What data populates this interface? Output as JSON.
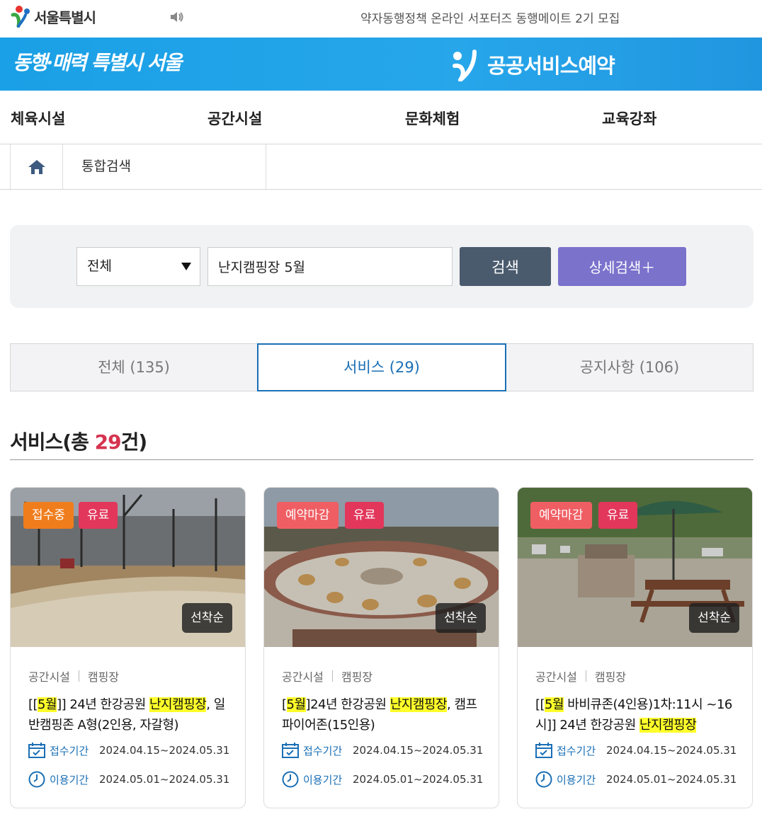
{
  "topbar": {
    "logo_text": "서울특별시",
    "notice": "약자동행정책 온라인 서포터즈 동행메이트 2기 모집"
  },
  "banner": {
    "slogan": "동행·매력 특별시 서울",
    "service_title": "공공서비스예약"
  },
  "nav": {
    "items": [
      "체육시설",
      "공간시설",
      "문화체험",
      "교육강좌"
    ]
  },
  "breadcrumb": {
    "current": "통합검색"
  },
  "search": {
    "category_selected": "전체",
    "query": "난지캠핑장 5월",
    "search_button": "검색",
    "advanced_button": "상세검색＋"
  },
  "tabs": [
    {
      "label": "전체 (135)",
      "active": false
    },
    {
      "label": "서비스 (29)",
      "active": true
    },
    {
      "label": "공지사항 (106)",
      "active": false
    }
  ],
  "section": {
    "title_prefix": "서비스(총 ",
    "count": "29",
    "title_suffix": "건)"
  },
  "cards": [
    {
      "status": "접수중",
      "fee": "유료",
      "order": "선착순",
      "category": "공간시설",
      "subcategory": "캠핑장",
      "title_parts": [
        "[[",
        "5월",
        "]] 24년 한강공원 ",
        "난지캠핑장",
        ", 일반캠핑존 A형(2인용, 자갈형)"
      ],
      "apply_label": "접수기간",
      "apply_period": "2024.04.15~2024.05.31",
      "use_label": "이용기간",
      "use_period": "2024.05.01~2024.05.31"
    },
    {
      "status": "예약마감",
      "fee": "유료",
      "order": "선착순",
      "category": "공간시설",
      "subcategory": "캠핑장",
      "title_parts": [
        "[",
        "5월",
        "]24년 한강공원 ",
        "난지캠핑장",
        ", 캠프파이어존(15인용)"
      ],
      "apply_label": "접수기간",
      "apply_period": "2024.04.15~2024.05.31",
      "use_label": "이용기간",
      "use_period": "2024.05.01~2024.05.31"
    },
    {
      "status": "예약마감",
      "fee": "유료",
      "order": "선착순",
      "category": "공간시설",
      "subcategory": "캠핑장",
      "title_parts": [
        "[[",
        "5월",
        " 바비큐존(4인용)1차:11시 ~16시]] 24년 한강공원 ",
        "난지캠핑장",
        ""
      ],
      "apply_label": "접수기간",
      "apply_period": "2024.04.15~2024.05.31",
      "use_label": "이용기간",
      "use_period": "2024.05.01~2024.05.31"
    }
  ],
  "colors": {
    "brand_blue": "#1aa0e6",
    "accent_count": "#d6334f",
    "tab_active": "#1a6fb5",
    "highlight": "#ffff2a",
    "status_open": "#f07d1c",
    "status_closed": "#ef5e63",
    "paid": "#e2375b"
  }
}
